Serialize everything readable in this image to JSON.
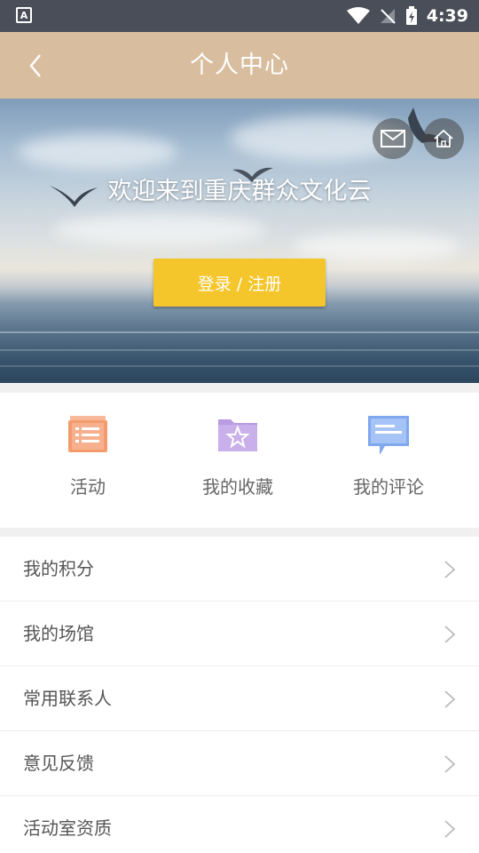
{
  "status_bar": {
    "time": "4:39",
    "notification_icon": "A"
  },
  "header": {
    "title": "个人中心",
    "back_icon": "chevron-left-icon"
  },
  "banner": {
    "welcome_text": "欢迎来到重庆群众文化云",
    "login_button": "登录 / 注册",
    "mail_icon": "mail-icon",
    "home_icon": "home-icon"
  },
  "quick_actions": [
    {
      "label": "活动",
      "icon": "activity-list-icon",
      "color": "#f39b6d"
    },
    {
      "label": "我的收藏",
      "icon": "favorite-folder-icon",
      "color": "#b89be0"
    },
    {
      "label": "我的评论",
      "icon": "comment-icon",
      "color": "#7fa8ef"
    }
  ],
  "menu": [
    {
      "label": "我的积分"
    },
    {
      "label": "我的场馆"
    },
    {
      "label": "常用联系人"
    },
    {
      "label": "意见反馈"
    },
    {
      "label": "活动室资质"
    }
  ],
  "colors": {
    "header_bg": "#d9bd9f",
    "login_button": "#f4c62b",
    "status_bar": "#4a4e58"
  }
}
